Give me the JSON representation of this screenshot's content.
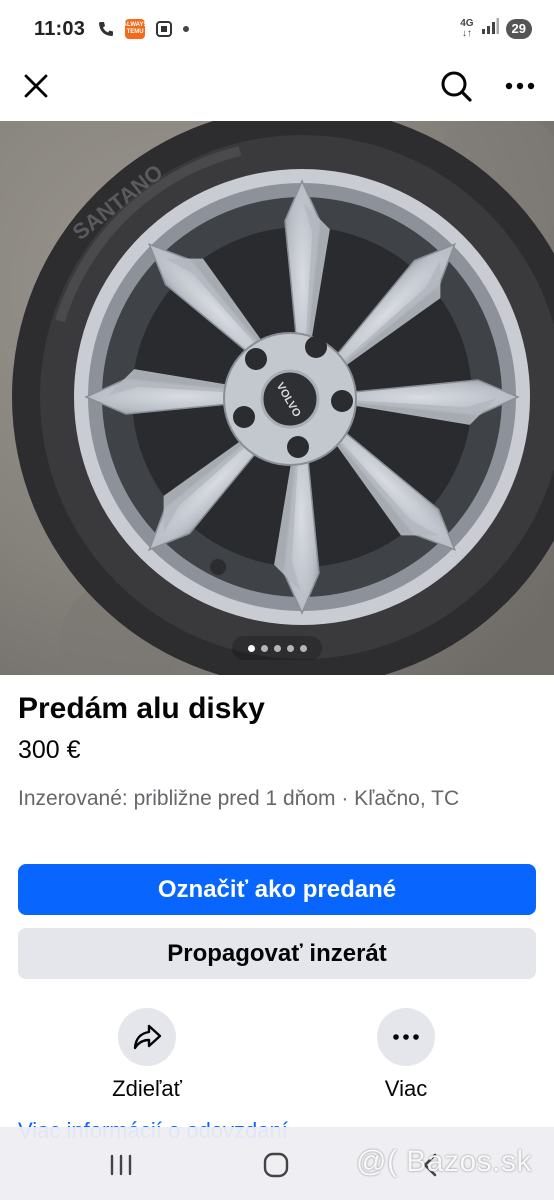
{
  "status_bar": {
    "time": "11:03",
    "temu_badge": "ALWAYS TEMU",
    "network_top": "4G",
    "network_bottom": "↓↑",
    "battery": "29"
  },
  "top_bar": {
    "icons": [
      "close-icon",
      "search-icon",
      "more-horizontal-icon"
    ]
  },
  "photo": {
    "hub_logo": "VOLVO",
    "tire_text": "SANTANO",
    "carousel": {
      "count": 5,
      "active_index": 0
    }
  },
  "listing": {
    "title": "Predám alu disky",
    "price": "300 €",
    "meta": "Inzerované: približne pred 1 dňom · Kľačno, TC"
  },
  "buttons": {
    "mark_sold": "Označiť ako predané",
    "promote": "Propagovať inzerát"
  },
  "actions": {
    "share_label": "Zdieľať",
    "more_label": "Viac"
  },
  "peek": {
    "text": "Viac informácií o odovzdaní"
  },
  "watermark": "@( Bazos.sk",
  "colors": {
    "primary": "#0866ff",
    "secondary_bg": "#e4e6eb",
    "meta_text": "#65676b"
  }
}
